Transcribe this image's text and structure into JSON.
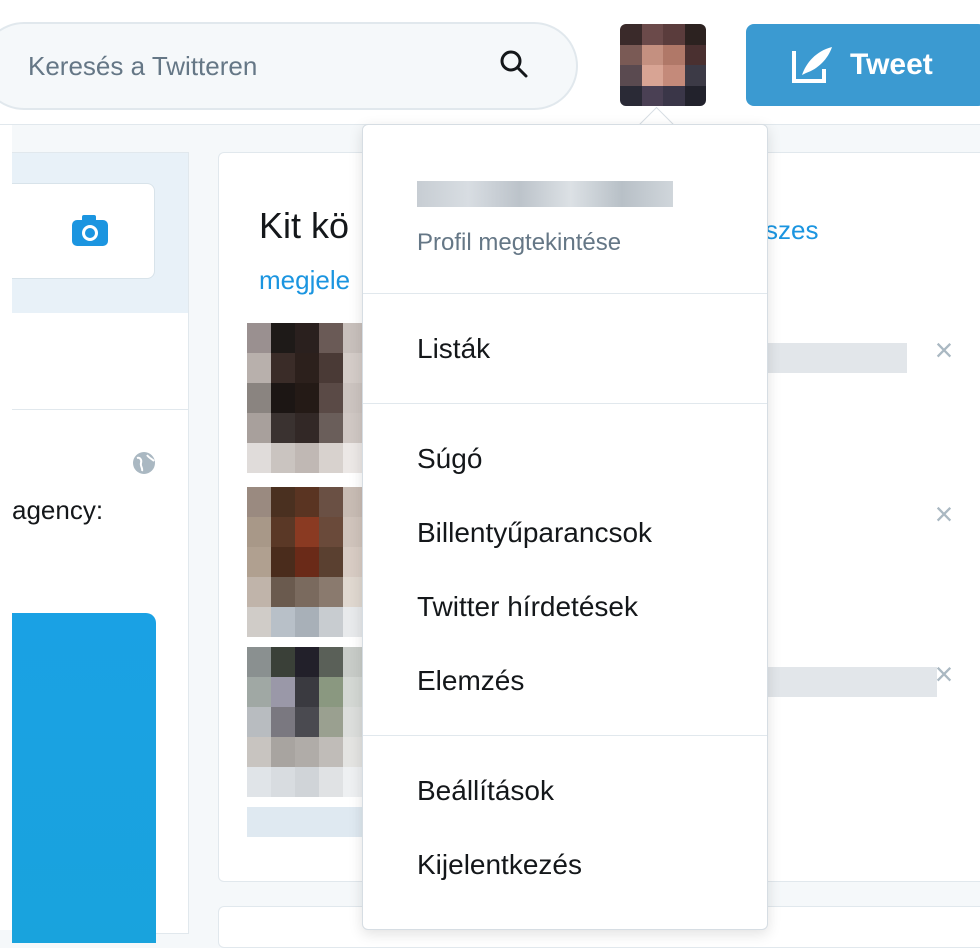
{
  "search": {
    "placeholder": "Keresés a Twitteren"
  },
  "header": {
    "tweet_label": "Tweet"
  },
  "left": {
    "agency_text": "agency:"
  },
  "who_to_follow": {
    "title": "Kit kö",
    "link_all": "szes",
    "link_show": "megjele",
    "suggestions": [
      {
        "close": "×"
      },
      {
        "close": "×"
      },
      {
        "close": "×"
      }
    ]
  },
  "dropdown": {
    "profile_link": "Profil megtekintése",
    "items": [
      "Listák",
      "Súgó",
      "Billentyűparancsok",
      "Twitter hírdetések",
      "Elemzés",
      "Beállítások",
      "Kijelentkezés"
    ]
  },
  "colors": {
    "accent": "#1b95e0",
    "tweet_button": "#3b9ad1",
    "promo_card": "#1aa1e4"
  }
}
